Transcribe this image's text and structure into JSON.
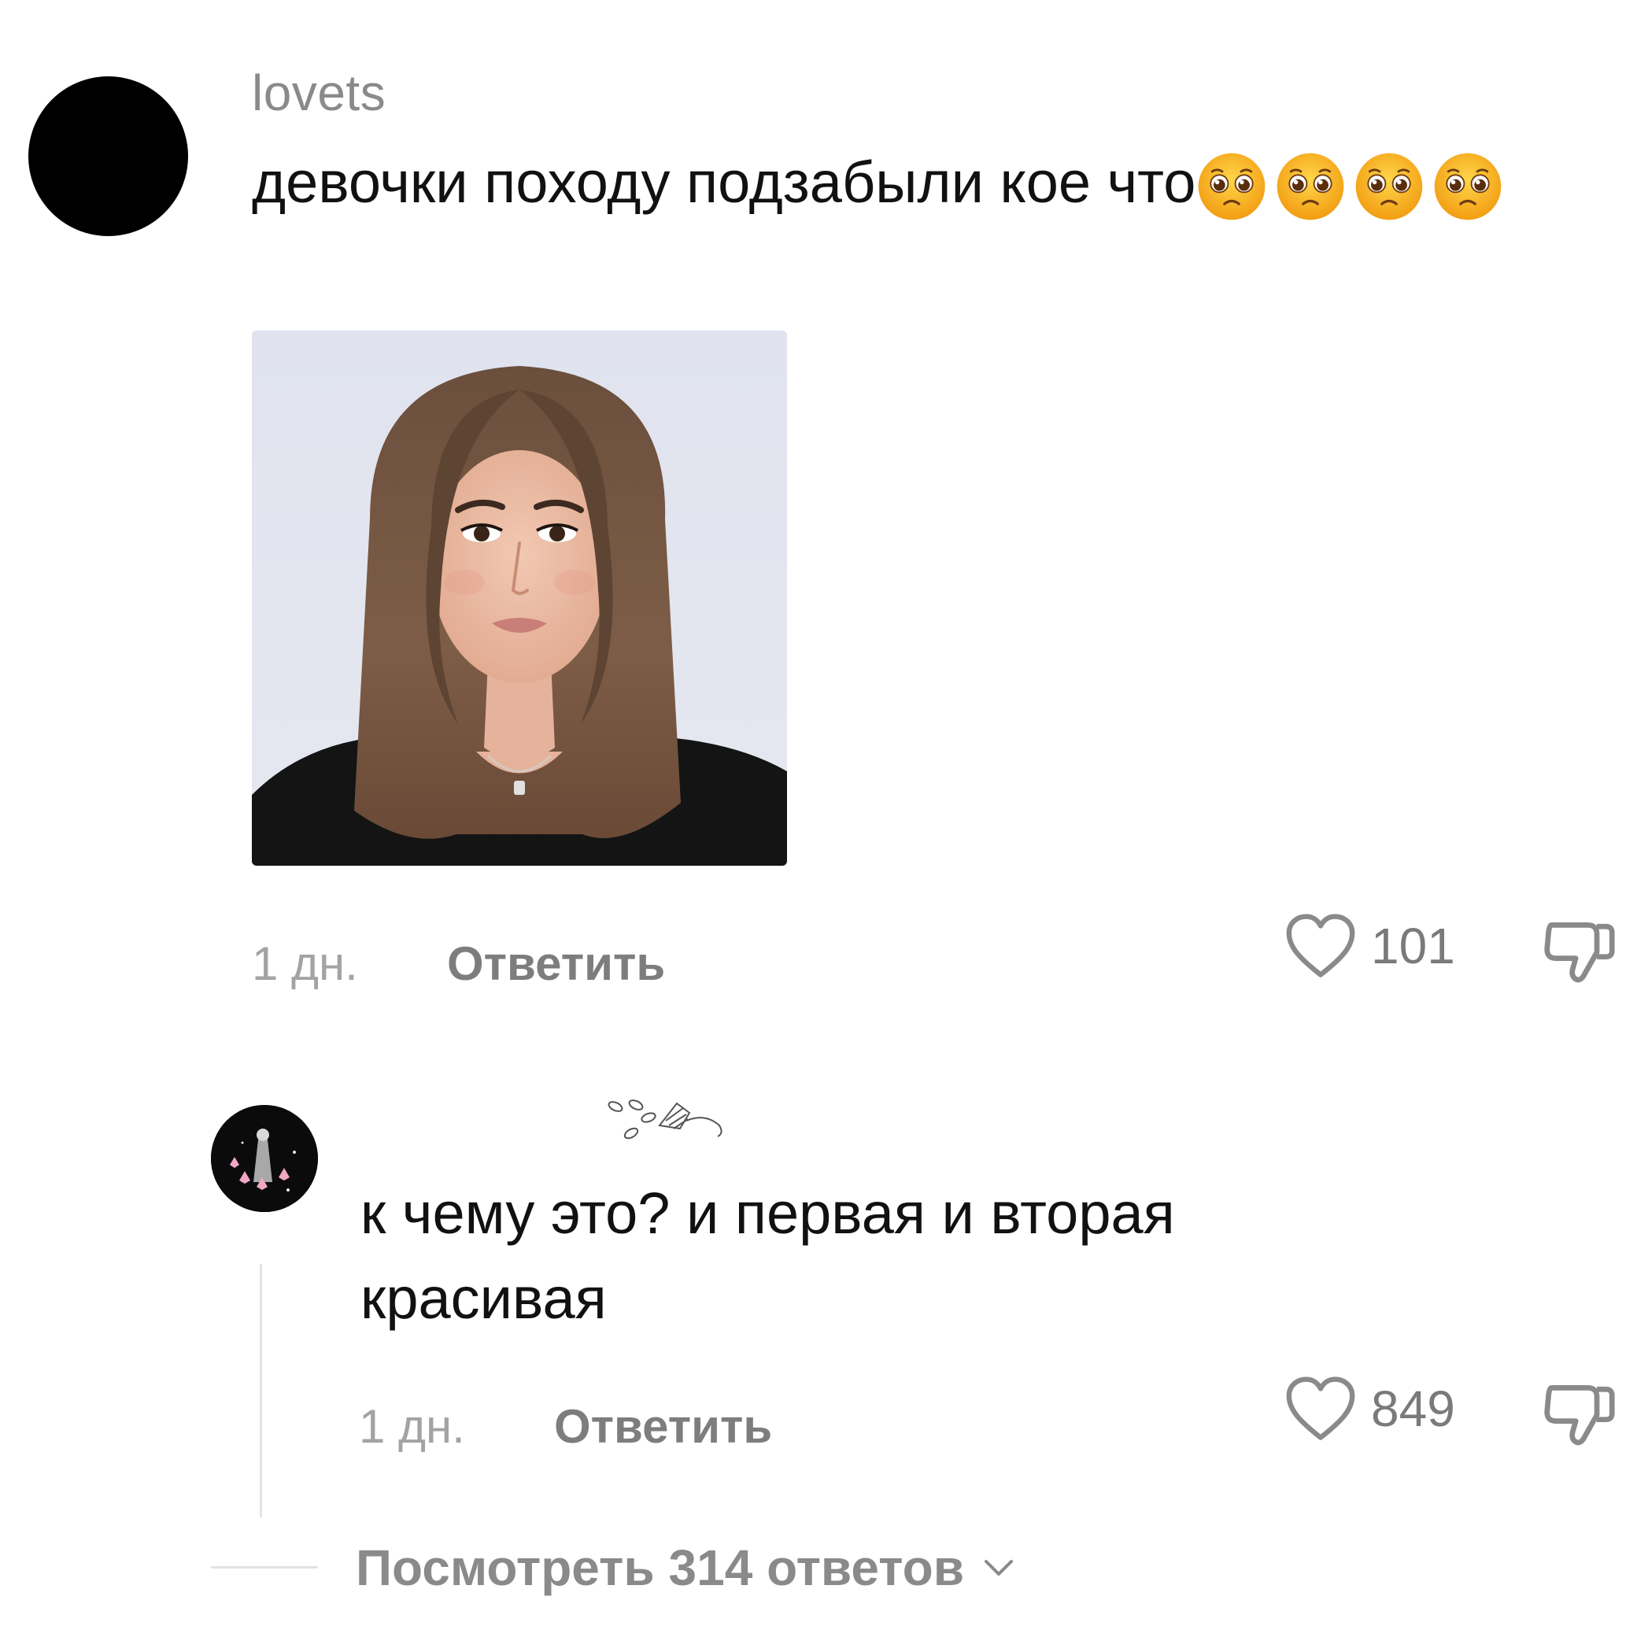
{
  "comment": {
    "username": "lovets",
    "text": "девочки походу подзабыли кое что",
    "emojis": [
      "pleading-face-emoji",
      "pleading-face-emoji",
      "pleading-face-emoji",
      "pleading-face-emoji"
    ],
    "time": "1 дн.",
    "reply_label": "Ответить",
    "likes": "101"
  },
  "reply": {
    "text": "к чему это? и первая и вторая красивая",
    "time": "1 дн.",
    "reply_label": "Ответить",
    "likes": "849"
  },
  "view_replies": {
    "label": "Посмотреть 314 ответов"
  },
  "icons": {
    "like": "heart-outline-icon",
    "dislike": "thumbs-down-outline-icon",
    "chevron": "chevron-down-icon"
  },
  "colors": {
    "text": "#111111",
    "muted": "#8a8a8a",
    "emoji": "#f7b500"
  }
}
